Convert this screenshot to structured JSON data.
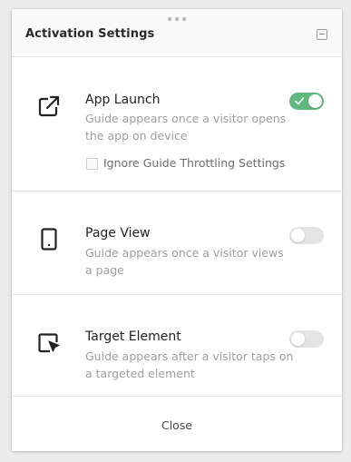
{
  "panel": {
    "title": "Activation Settings"
  },
  "options": [
    {
      "title": "App Launch",
      "description": "Guide appears once a visitor opens the app on device",
      "enabled": true,
      "icon": "external-link-icon",
      "checkbox": {
        "label": "Ignore Guide Throttling Settings",
        "checked": false
      }
    },
    {
      "title": "Page View",
      "description": "Guide appears once a visitor views a page",
      "enabled": false,
      "icon": "mobile-device-icon"
    },
    {
      "title": "Target Element",
      "description": "Guide appears after a visitor taps on a targeted element",
      "enabled": false,
      "icon": "target-cursor-icon"
    }
  ],
  "footer": {
    "close_label": "Close"
  },
  "colors": {
    "toggle_on": "#5fb97e",
    "toggle_off": "#e4e4e4",
    "title_text": "#2a2a2a",
    "description_text": "#9e9e9e"
  }
}
